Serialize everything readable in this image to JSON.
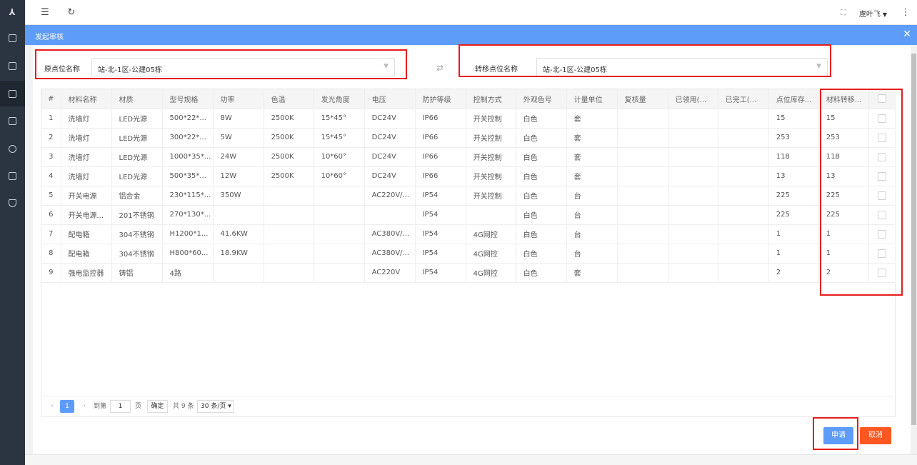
{
  "topbar": {
    "user_name": "虞叶飞"
  },
  "dialog": {
    "title": "发起审核"
  },
  "origin": {
    "label": "原点位名称",
    "value": "站-北-1区-公建05栋"
  },
  "target": {
    "label": "转移点位名称",
    "value": "站-北-1区-公建05栋"
  },
  "table": {
    "headers": [
      "#",
      "材料名称",
      "材质",
      "型号规格",
      "功率",
      "色温",
      "发光角度",
      "电压",
      "防护等级",
      "控制方式",
      "外观色号",
      "计量单位",
      "复核量",
      "已领用(...",
      "已完工(...",
      "点位库存...",
      "材料转移..."
    ],
    "rows": [
      [
        "1",
        "洗墙灯",
        "LED光源",
        "500*22*...",
        "8W",
        "2500K",
        "15*45°",
        "DC24V",
        "IP66",
        "开关控制",
        "白色",
        "套",
        "",
        "",
        "",
        "15",
        "15"
      ],
      [
        "2",
        "洗墙灯",
        "LED光源",
        "300*22*...",
        "5W",
        "2500K",
        "15*45°",
        "DC24V",
        "IP66",
        "开关控制",
        "白色",
        "套",
        "",
        "",
        "",
        "253",
        "253"
      ],
      [
        "3",
        "洗墙灯",
        "LED光源",
        "1000*35*...",
        "24W",
        "2500K",
        "10*60°",
        "DC24V",
        "IP66",
        "开关控制",
        "白色",
        "套",
        "",
        "",
        "",
        "118",
        "118"
      ],
      [
        "4",
        "洗墙灯",
        "LED光源",
        "500*35*...",
        "12W",
        "2500K",
        "10*60°",
        "DC24V",
        "IP66",
        "开关控制",
        "白色",
        "套",
        "",
        "",
        "",
        "13",
        "13"
      ],
      [
        "5",
        "开关电源",
        "铝合金",
        "230*115*...",
        "350W",
        "",
        "",
        "AC220V/...",
        "IP54",
        "开关控制",
        "白色",
        "台",
        "",
        "",
        "",
        "225",
        "225"
      ],
      [
        "6",
        "开关电源...",
        "201不锈钢",
        "270*130*...",
        "",
        "",
        "",
        "",
        "IP54",
        "",
        "白色",
        "台",
        "",
        "",
        "",
        "225",
        "225"
      ],
      [
        "7",
        "配电箱",
        "304不锈钢",
        "H1200*1...",
        "41.6KW",
        "",
        "",
        "AC380V/...",
        "IP54",
        "4G网控",
        "白色",
        "台",
        "",
        "",
        "",
        "1",
        "1"
      ],
      [
        "8",
        "配电箱",
        "304不锈钢",
        "H800*60...",
        "18.9KW",
        "",
        "",
        "AC380V/...",
        "IP54",
        "4G网控",
        "白色",
        "台",
        "",
        "",
        "",
        "1",
        "1"
      ],
      [
        "9",
        "强电监控器",
        "铸铝",
        "4路",
        "",
        "",
        "",
        "AC220V",
        "IP54",
        "4G网控",
        "白色",
        "套",
        "",
        "",
        "",
        "2",
        "2"
      ]
    ]
  },
  "pager": {
    "current": "1",
    "goto_label": "到第",
    "page_input": "1",
    "page_unit": "页",
    "confirm": "确定",
    "total": "共 9 条",
    "page_size": "30 条/页"
  },
  "buttons": {
    "apply": "申请",
    "cancel": "取消"
  },
  "icons": {
    "menu": "menu-fold-icon",
    "refresh": "refresh-icon",
    "fullscreen": "fullscreen-icon",
    "more": "more-vertical-icon",
    "swap": "swap-icon",
    "close": "close-icon"
  },
  "colors": {
    "primary": "#5d9cf8",
    "danger": "#ff5722",
    "sidebar": "#2b3541",
    "annotation": "#e81c1c"
  }
}
